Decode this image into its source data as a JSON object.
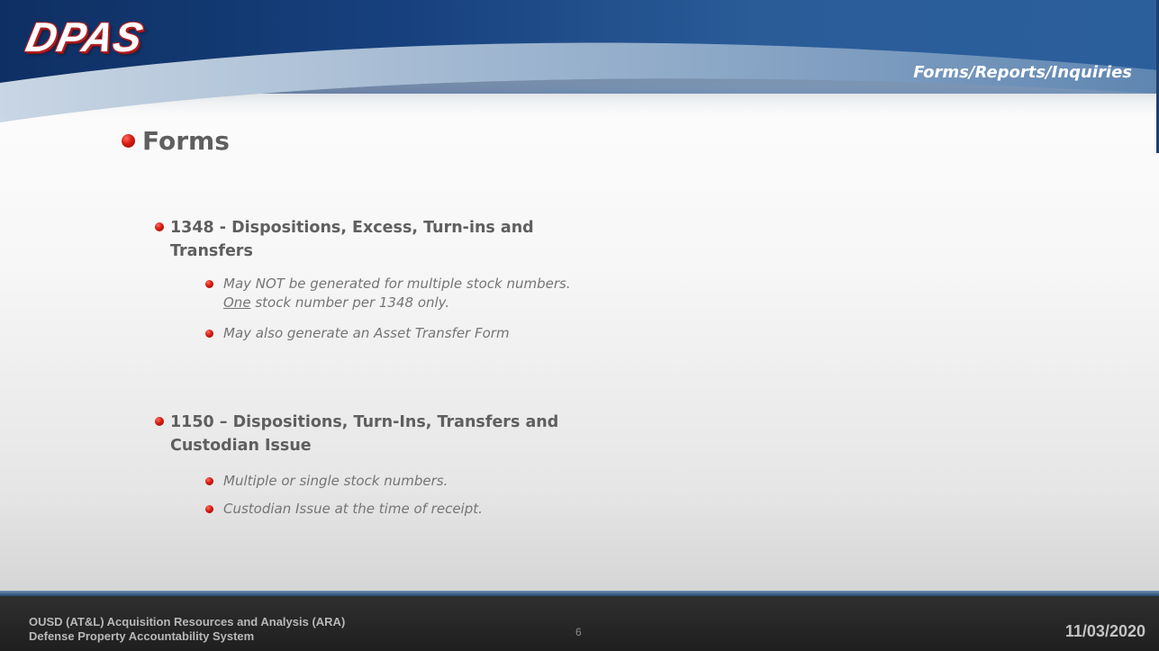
{
  "header": {
    "logo_text": "DPAS",
    "section_title": "Forms/Reports/Inquiries"
  },
  "content": {
    "heading": "Forms",
    "items": [
      {
        "title_line1": "1348 - Dispositions, Excess, Turn-ins and",
        "title_line2": "Transfers",
        "subitems": [
          {
            "line1": "May NOT be generated for multiple stock numbers.",
            "underlined": "One",
            "line2_rest": " stock number per 1348 only."
          },
          {
            "text": "May also generate an Asset Transfer Form"
          }
        ]
      },
      {
        "title_line1": "1150 – Dispositions, Turn-Ins, Transfers and",
        "title_line2": "Custodian Issue",
        "subitems": [
          {
            "text": "Multiple or single stock numbers."
          },
          {
            "text": "Custodian Issue at the time of receipt."
          }
        ]
      }
    ]
  },
  "footer": {
    "org_line1": "OUSD (AT&L) Acquisition Resources and Analysis (ARA)",
    "org_line2": "Defense Property Accountability System",
    "page_number": "6",
    "date": "11/03/2020"
  }
}
